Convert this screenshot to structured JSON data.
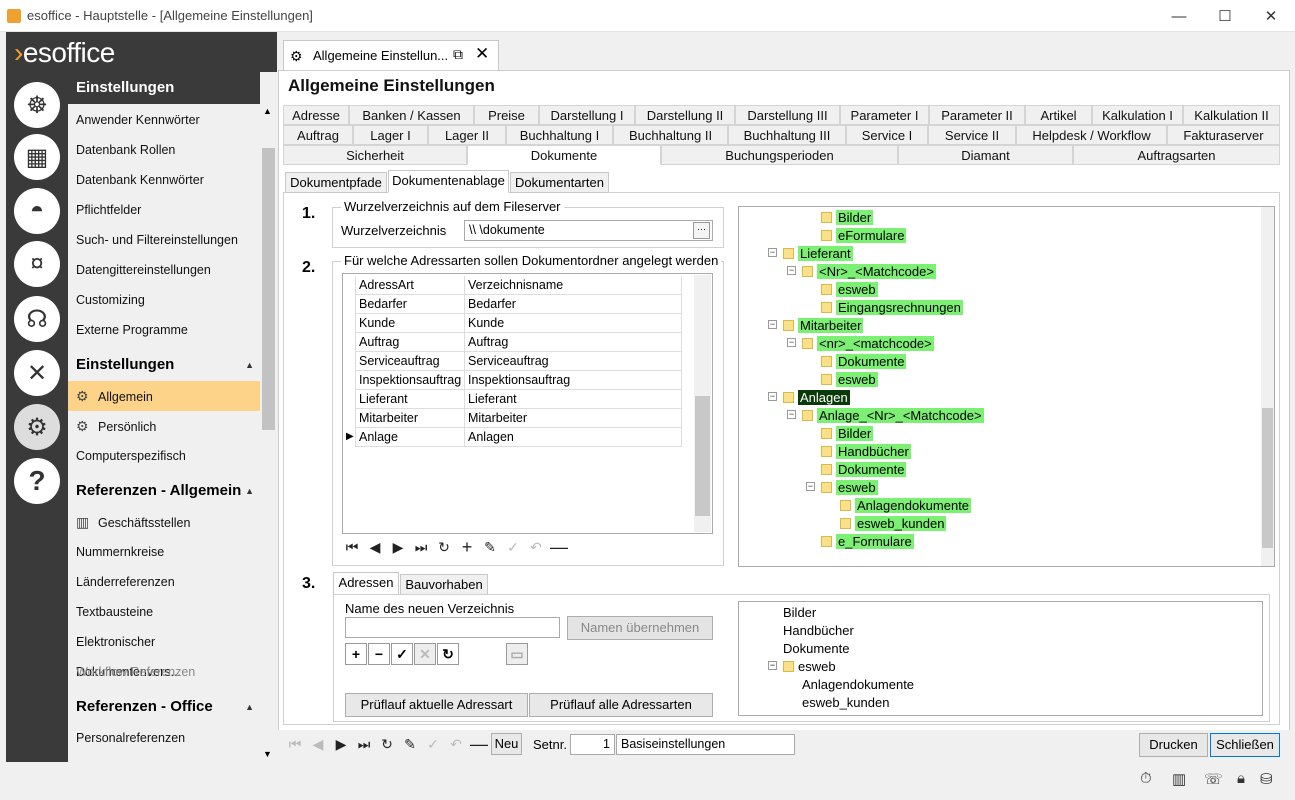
{
  "window": {
    "title": "esoffice - Hauptstelle - [Allgemeine Einstellungen]",
    "minimize": "—",
    "maximize": "☐",
    "close": "✕"
  },
  "logo": {
    "text": "esoffice"
  },
  "rail_icons": [
    "helm-icon",
    "calendar-icon",
    "alarm-light-icon",
    "money-icon",
    "headset-icon",
    "tools-icon",
    "gears-icon",
    "help-icon"
  ],
  "nav": {
    "section1": "Einstellungen",
    "items1": [
      "Anwender Kennwörter",
      "Datenbank Rollen",
      "Datenbank Kennwörter",
      "Pflichtfelder",
      "Such- und Filtereinstellungen",
      "Datengittereinstellungen",
      "Customizing",
      "Externe Programme"
    ],
    "section2": "Einstellungen",
    "items2": [
      "Allgemein",
      "Persönlich",
      "Computerspezifisch"
    ],
    "section3": "Referenzen - Allgemein",
    "items3": [
      "Geschäftsstellen",
      "Nummernkreise",
      "Länderreferenzen",
      "Textbausteine",
      "Elektronischer Dokumentenvers...",
      "Workflow Referenzen"
    ],
    "section4": "Referenzen - Office",
    "items4": [
      "Personalreferenzen"
    ]
  },
  "doc_tab": {
    "label": "Allgemeine Einstellun..."
  },
  "main_title": "Allgemeine Einstellungen",
  "tabs_row1": [
    "Adresse",
    "Banken / Kassen",
    "Preise",
    "Darstellung I",
    "Darstellung II",
    "Darstellung III",
    "Parameter I",
    "Parameter II",
    "Artikel",
    "Kalkulation I",
    "Kalkulation II"
  ],
  "tabs_row2": [
    "Auftrag",
    "Lager I",
    "Lager II",
    "Buchhaltung I",
    "Buchhaltung II",
    "Buchhaltung III",
    "Service I",
    "Service II",
    "Helpdesk / Workflow",
    "Fakturaserver"
  ],
  "tabs_row3": [
    "Sicherheit",
    "Dokumente",
    "Buchungsperioden",
    "Diamant",
    "Auftragsarten"
  ],
  "subtabs": [
    "Dokumentpfade",
    "Dokumentenablage",
    "Dokumentarten"
  ],
  "section1": {
    "num": "1.",
    "legend": "Wurzelverzeichnis auf dem Fileserver",
    "label": "Wurzelverzeichnis",
    "value": "\\\\              \\dokumente",
    "ellipsis": "···"
  },
  "section2": {
    "num": "2.",
    "legend": "Für welche Adressarten sollen Dokumentordner angelegt werden",
    "columns": [
      "AdressArt",
      "Verzeichnisname"
    ],
    "rows": [
      [
        "Bedarfer",
        "Bedarfer"
      ],
      [
        "Kunde",
        "Kunde"
      ],
      [
        "Auftrag",
        "Auftrag"
      ],
      [
        "Serviceauftrag",
        "Serviceauftrag"
      ],
      [
        "Inspektionsauftrag",
        "Inspektionsauftrag"
      ],
      [
        "Lieferant",
        "Lieferant"
      ],
      [
        "Mitarbeiter",
        "Mitarbeiter"
      ],
      [
        "Anlage",
        "Anlagen"
      ]
    ]
  },
  "tree": {
    "nodes": [
      "Bilder",
      "eFormulare",
      "Lieferant",
      "<Nr>_<Matchcode>",
      "esweb",
      "Eingangsrechnungen",
      "Mitarbeiter",
      "<nr>_<matchcode>",
      "Dokumente",
      "esweb",
      "Anlagen",
      "Anlage_<Nr>_<Matchcode>",
      "Bilder",
      "Handbücher",
      "Dokumente",
      "esweb",
      "Anlagendokumente",
      "esweb_kunden",
      "e_Formulare"
    ]
  },
  "section3": {
    "num": "3.",
    "tabs": [
      "Adressen",
      "Bauvorhaben"
    ],
    "name_label": "Name des neuen Verzeichnis",
    "name_value": "",
    "apply_button": "Namen übernehmen",
    "check_current": "Prüflauf aktuelle Adressart",
    "check_all": "Prüflauf alle Adressarten",
    "tree": [
      "Bilder",
      "Handbücher",
      "Dokumente",
      "esweb",
      "Anlagendokumente",
      "esweb_kunden"
    ]
  },
  "bottom": {
    "new_button": "Neu",
    "setnr_label": "Setnr.",
    "setnr_value": "1",
    "set_name": "Basiseinstellungen",
    "print_button": "Drucken",
    "close_button": "Schließen"
  }
}
